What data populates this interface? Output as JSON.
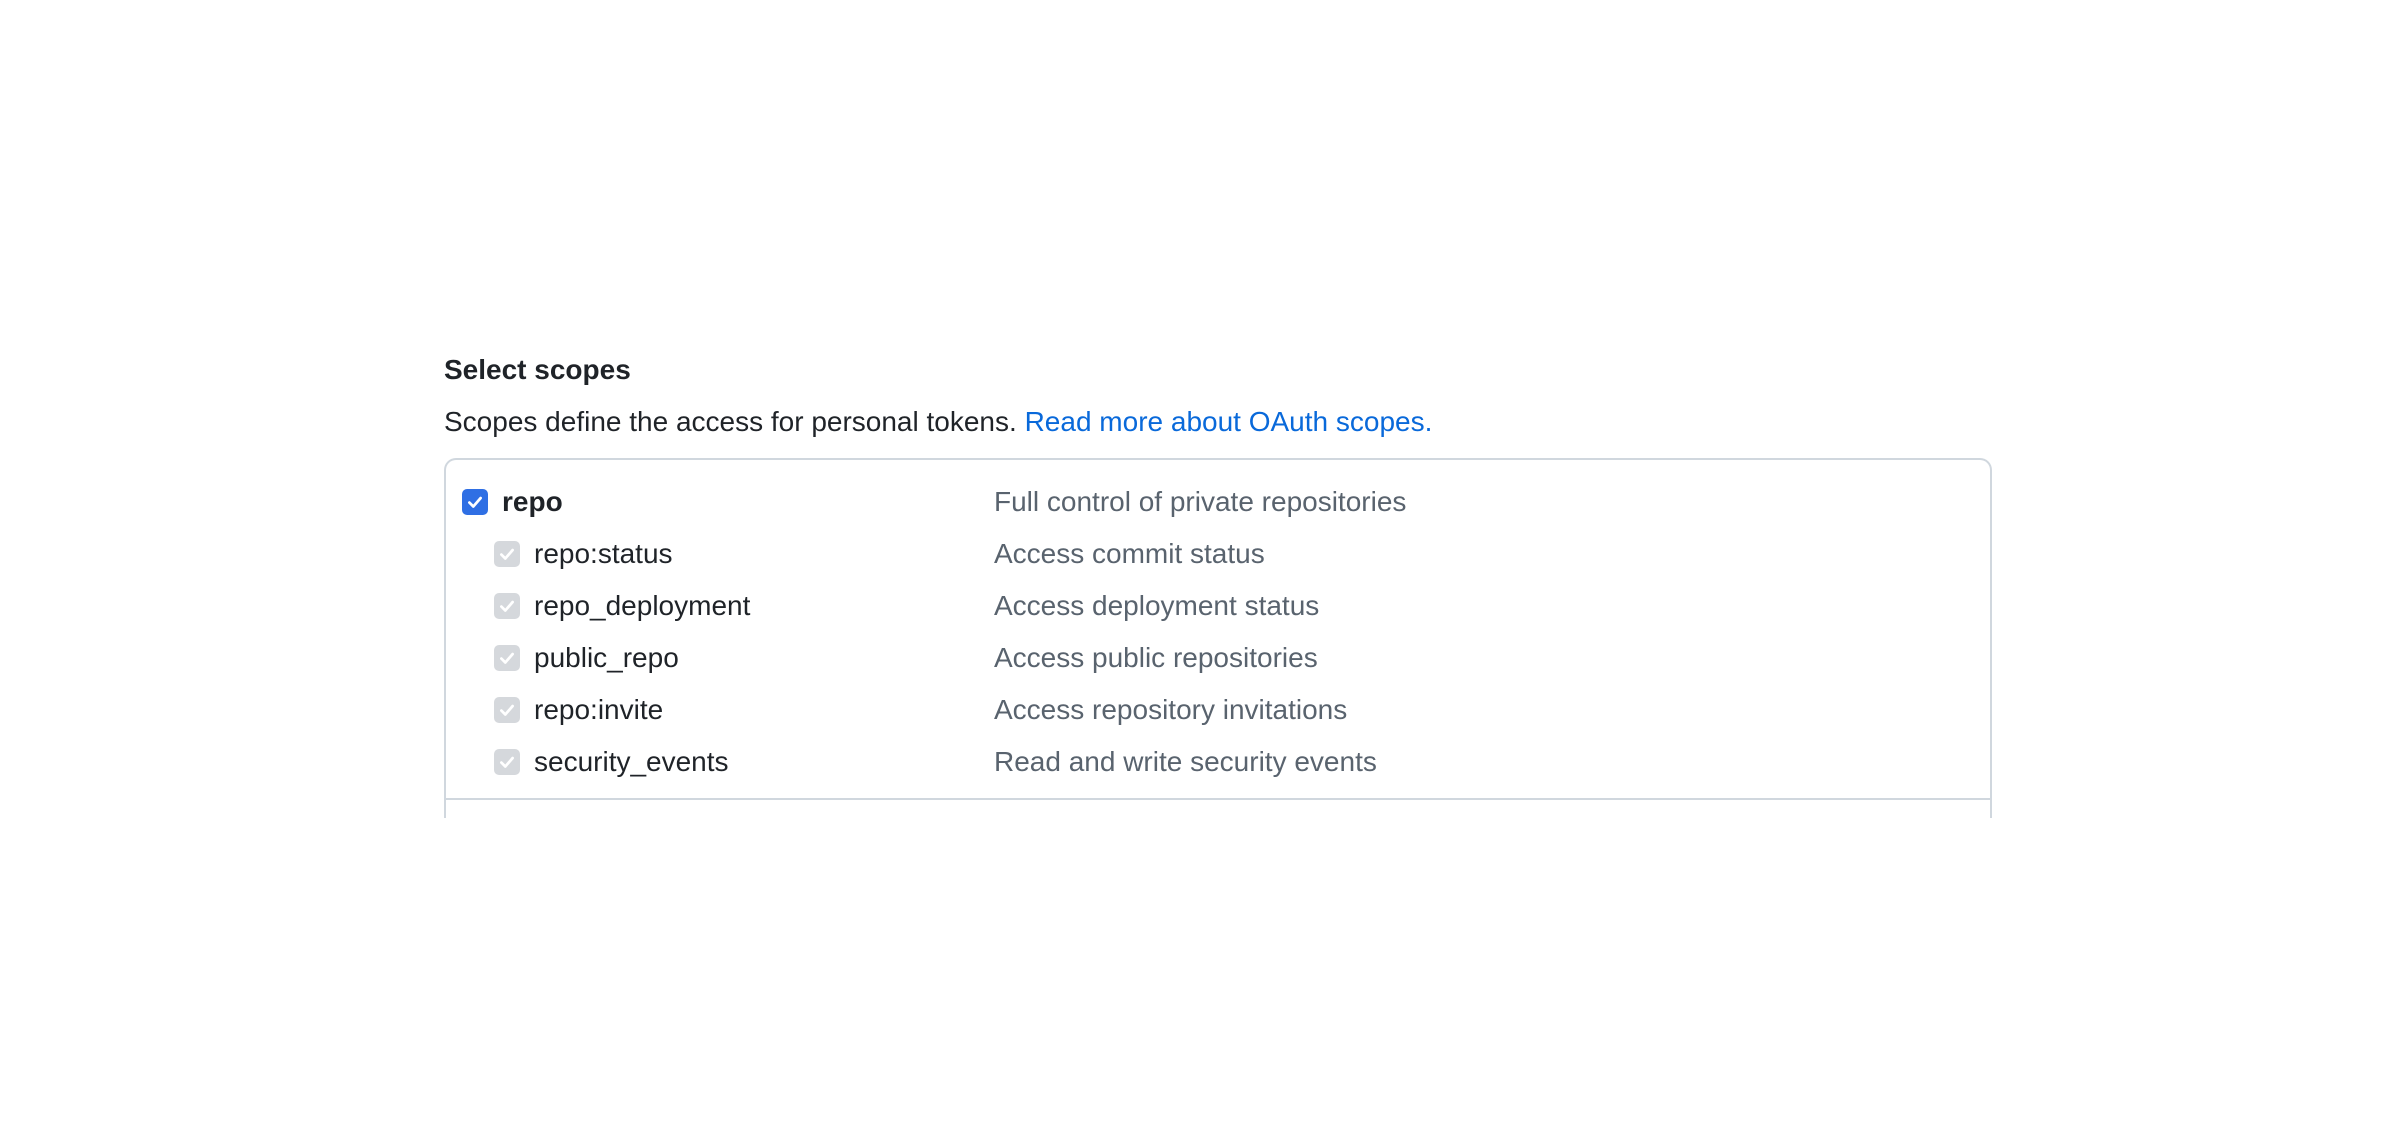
{
  "section": {
    "title": "Select scopes",
    "description": "Scopes define the access for personal tokens.",
    "link_text": "Read more about OAuth scopes."
  },
  "scopes": {
    "parent": {
      "name": "repo",
      "description": "Full control of private repositories",
      "checked": true
    },
    "children": [
      {
        "name": "repo:status",
        "description": "Access commit status",
        "checked": true
      },
      {
        "name": "repo_deployment",
        "description": "Access deployment status",
        "checked": true
      },
      {
        "name": "public_repo",
        "description": "Access public repositories",
        "checked": true
      },
      {
        "name": "repo:invite",
        "description": "Access repository invitations",
        "checked": true
      },
      {
        "name": "security_events",
        "description": "Read and write security events",
        "checked": true
      }
    ]
  },
  "colors": {
    "accent": "#2f6fe4",
    "link": "#0969da",
    "disabled_check": "#d5d8dc",
    "border": "#d0d7de",
    "muted_text": "#59636e"
  }
}
